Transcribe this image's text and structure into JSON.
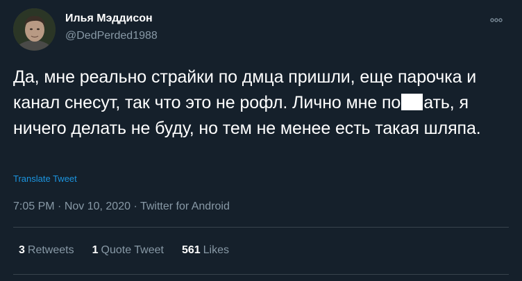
{
  "user": {
    "display_name": "Илья Мэддисон",
    "handle": "@DedPerded1988"
  },
  "tweet": {
    "text_before_redaction": "Да, мне реально страйки по дмца пришли, еще парочка и канал снесут, так что это не рофл. Лично мне по",
    "text_after_redaction": "ать, я ничего делать не буду, но тем не менее есть такая шляпа.",
    "translate_label": "Translate Tweet",
    "time": "7:05 PM",
    "date": "Nov 10, 2020",
    "source": "Twitter for Android",
    "separator": " · "
  },
  "stats": {
    "retweets_count": "3",
    "retweets_label": "Retweets",
    "quote_count": "1",
    "quote_label": "Quote Tweet",
    "likes_count": "561",
    "likes_label": "Likes"
  },
  "icons": {
    "more": "more-options-icon",
    "avatar": "avatar-photo"
  },
  "colors": {
    "background": "#15202b",
    "text_primary": "#ffffff",
    "text_secondary": "#8899a6",
    "link": "#1b95e0",
    "divider": "#38444d"
  }
}
